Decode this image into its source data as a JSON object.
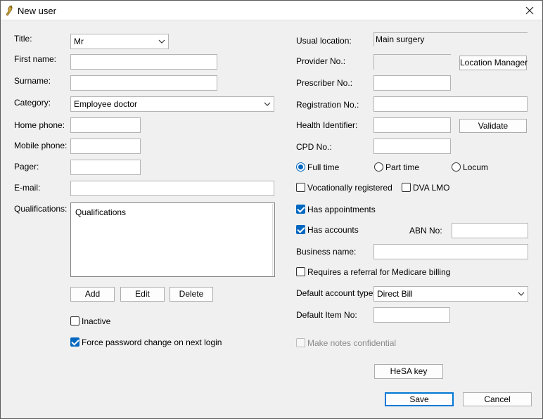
{
  "window": {
    "title": "New user"
  },
  "icons": {
    "app": "app-icon",
    "close": "close-icon",
    "dropdown": "chevron-down-icon"
  },
  "colors": {
    "accent": "#0067c0",
    "default_button_border": "#0078d4"
  },
  "left": {
    "title_label": "Title:",
    "title_value": "Mr",
    "first_name_label": "First name:",
    "first_name_value": "",
    "surname_label": "Surname:",
    "surname_value": "",
    "category_label": "Category:",
    "category_value": "Employee doctor",
    "home_phone_label": "Home phone:",
    "home_phone_value": "",
    "mobile_phone_label": "Mobile phone:",
    "mobile_phone_value": "",
    "pager_label": "Pager:",
    "pager_value": "",
    "email_label": "E-mail:",
    "email_value": "",
    "qualifications_label": "Qualifications:",
    "qualifications_value": "Qualifications",
    "add_button": "Add",
    "edit_button": "Edit",
    "delete_button": "Delete",
    "inactive_label": "Inactive",
    "inactive_checked": false,
    "force_password_label": "Force password change on next login",
    "force_password_checked": true
  },
  "right": {
    "usual_location_label": "Usual location:",
    "usual_location_value": "Main surgery",
    "provider_no_label": "Provider No.:",
    "provider_no_value": "",
    "location_manager_button": "Location Manager",
    "prescriber_no_label": "Prescriber No.:",
    "prescriber_no_value": "",
    "registration_no_label": "Registration No.:",
    "registration_no_value": "",
    "health_identifier_label": "Health Identifier:",
    "health_identifier_value": "",
    "validate_button": "Validate",
    "cpd_no_label": "CPD No.:",
    "cpd_no_value": "",
    "employment": {
      "full_time": "Full time",
      "part_time": "Part time",
      "locum": "Locum",
      "selected": "full_time"
    },
    "vocationally_registered_label": "Vocationally registered",
    "dva_lmo_label": "DVA LMO",
    "has_appointments_label": "Has appointments",
    "has_accounts_label": "Has accounts",
    "abn_no_label": "ABN No:",
    "abn_no_value": "",
    "business_name_label": "Business name:",
    "business_name_value": "",
    "requires_referral_label": "Requires a referral for Medicare billing",
    "default_account_type_label": "Default account type:",
    "default_account_type_value": "Direct Bill",
    "default_item_no_label": "Default Item No:",
    "default_item_no_value": "",
    "make_notes_confidential_label": "Make notes confidential",
    "hesa_key_button": "HeSA key"
  },
  "footer": {
    "save_button": "Save",
    "cancel_button": "Cancel"
  }
}
